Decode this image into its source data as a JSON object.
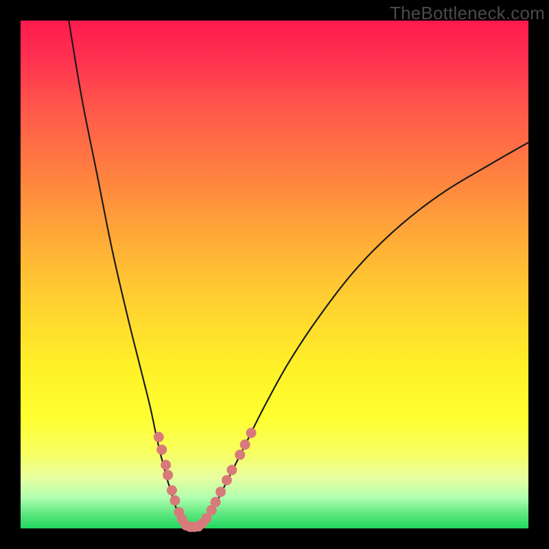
{
  "watermark": "TheBottleneck.com",
  "colors": {
    "frame": "#000000",
    "curve": "#1a1a1a",
    "dot": "#d97a7a",
    "gradient_top": "#ff1a4d",
    "gradient_bottom": "#20d860"
  },
  "chart_data": {
    "type": "line",
    "title": "",
    "xlabel": "",
    "ylabel": "",
    "xlim": [
      0,
      100
    ],
    "ylim": [
      0,
      100
    ],
    "series": [
      {
        "name": "left-curve",
        "x": [
          9.5,
          12,
          15,
          18,
          21,
          23.5,
          25.5,
          27,
          28.5,
          30,
          31,
          32,
          33
        ],
        "y": [
          100,
          85,
          70,
          55,
          42,
          32,
          24,
          17,
          11,
          6,
          3,
          1,
          0
        ]
      },
      {
        "name": "right-curve",
        "x": [
          35,
          36,
          37.5,
          39,
          41,
          44,
          48,
          53,
          59,
          66,
          74,
          83,
          93,
          100
        ],
        "y": [
          0,
          1,
          3,
          6,
          10,
          16,
          24,
          33,
          42,
          51,
          59,
          66,
          72,
          76
        ]
      },
      {
        "name": "flat-bottom",
        "x": [
          33,
          34,
          35
        ],
        "y": [
          0,
          0,
          0
        ]
      }
    ],
    "scatter_overlay": {
      "name": "dots",
      "points": [
        {
          "x": 27.2,
          "y": 18
        },
        {
          "x": 27.8,
          "y": 15.5
        },
        {
          "x": 28.6,
          "y": 12.5
        },
        {
          "x": 29.0,
          "y": 10.5
        },
        {
          "x": 29.8,
          "y": 7.5
        },
        {
          "x": 30.4,
          "y": 5.5
        },
        {
          "x": 31.2,
          "y": 3.2
        },
        {
          "x": 31.8,
          "y": 1.8
        },
        {
          "x": 32.6,
          "y": 0.6
        },
        {
          "x": 33.4,
          "y": 0.3
        },
        {
          "x": 34.2,
          "y": 0.3
        },
        {
          "x": 35.0,
          "y": 0.4
        },
        {
          "x": 35.8,
          "y": 1.0
        },
        {
          "x": 36.6,
          "y": 2.0
        },
        {
          "x": 37.6,
          "y": 3.6
        },
        {
          "x": 38.4,
          "y": 5.2
        },
        {
          "x": 39.4,
          "y": 7.2
        },
        {
          "x": 40.6,
          "y": 9.5
        },
        {
          "x": 41.6,
          "y": 11.5
        },
        {
          "x": 43.2,
          "y": 14.5
        },
        {
          "x": 44.2,
          "y": 16.5
        },
        {
          "x": 45.4,
          "y": 18.8
        }
      ]
    }
  }
}
